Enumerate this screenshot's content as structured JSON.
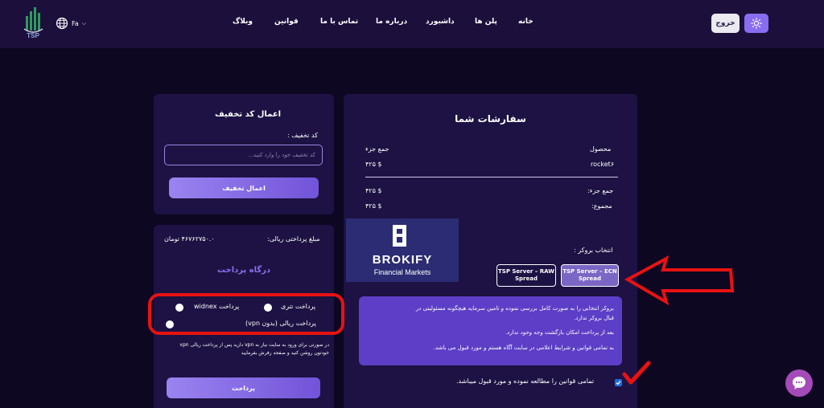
{
  "header": {
    "logo_text": "TSP",
    "lang": "Fa",
    "nav": [
      "خانه",
      "پلن ها",
      "داشبورد",
      "درباره ما",
      "تماس با ما",
      "قوانین",
      "وبلاگ"
    ],
    "logout_label": "خروج"
  },
  "order": {
    "title": "سفارشات شما",
    "col_product": "محصول",
    "col_subtotal": "جمع جزء",
    "product_name": "rocket۶",
    "product_price": "$ ۴۲۵",
    "subtotal_label": "جمع جزء:",
    "subtotal_value": "$ ۴۲۵",
    "total_label": "مجموع:",
    "total_value": "$ ۴۲۵",
    "broker_label": "انتخاب بروکر :",
    "brokers": [
      {
        "line1": "TSP Server – RAW",
        "line2": "Spread",
        "selected": false
      },
      {
        "line1": "TSP Server – ECN",
        "line2": "Spread",
        "selected": true
      }
    ],
    "brokify_name": "BROKIFY",
    "brokify_sub": "Financial Markets",
    "info_lines": [
      "بروکر انتخابی را به صورت کامل بررسی نموده و تامین سرمایه هیچگونه مسئولیتی در",
      "قبال بروکر ندارد.",
      "بعد از پرداخت امکان بازگشت وجه وجود ندارد.",
      "به تمامی قوانین و شرایط اعلامی در سایت آگاه هستم و مورد قبول می باشد."
    ],
    "agree_text": "تمامی قوانین را مطالعه نموده و مورد قبول میباشد.",
    "agree_checked": true
  },
  "discount": {
    "title": "اعمال کد تخفیف",
    "field_label": "کد تخفیف :",
    "placeholder": "کد تخفیف خود را وارد کنید...",
    "apply_label": "اعمال تخفیف"
  },
  "payment": {
    "amount_label": "مبلغ پرداختی ریالی:",
    "amount_value": "۴۶۷۶۲۷۵۰.۰ تومان",
    "gateway_title": "درگاه پرداخت",
    "options": [
      "پرداخت تتری",
      "پرداخت widnex",
      "پرداخت ریالی (بدون vpn)"
    ],
    "note": "در صورتی برای ورود به سایت نیاز به vpn دارید پس از پرداخت ریالی vpn خودتون روشن کنید و صفحه رفرش بفرمایید",
    "pay_label": "پرداخت"
  },
  "colors": {
    "background": "#0e0722",
    "header": "#1c0f3b",
    "panel": "#1d1243",
    "accent": "#8a6cf0",
    "annotation_red": "#e81212"
  }
}
